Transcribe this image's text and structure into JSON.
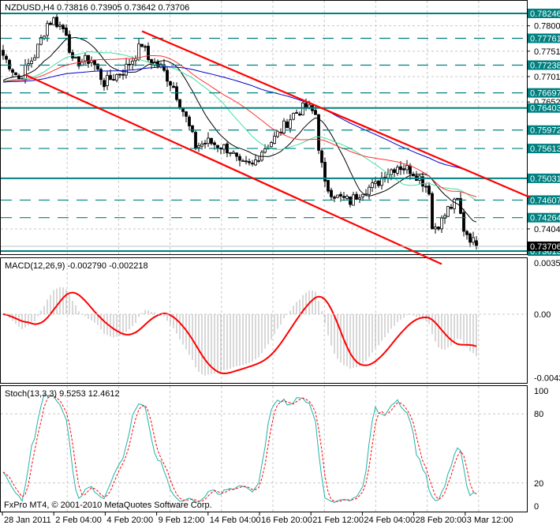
{
  "chart_data": {
    "type": "candlestick",
    "symbol_header": "NZDUSD,H4  0.73816 0.73905 0.73642 0.73706",
    "current_price": "0.73706",
    "price_axis": {
      "ylim": [
        0.7336,
        0.785
      ],
      "plain_ticks": [
        "0.78005",
        "0.77510",
        "0.77015",
        "0.76520",
        "0.74045"
      ],
      "levels": [
        {
          "label": "0.78246",
          "style": "solid"
        },
        {
          "label": "0.77761",
          "style": "dashed"
        },
        {
          "label": "0.77238",
          "style": "dashed"
        },
        {
          "label": "0.76697",
          "style": "dashed"
        },
        {
          "label": "0.76403",
          "style": "solid"
        },
        {
          "label": "0.75972",
          "style": "dashed"
        },
        {
          "label": "0.75613",
          "style": "dashed"
        },
        {
          "label": "0.75031",
          "style": "solid"
        },
        {
          "label": "0.74607",
          "style": "dashed"
        },
        {
          "label": "0.74264",
          "style": "dashed"
        },
        {
          "label": "0.73613",
          "style": "solid"
        }
      ]
    },
    "close_path": [
      [
        0,
        0.7743
      ],
      [
        5,
        0.7697
      ],
      [
        10,
        0.7743
      ],
      [
        14,
        0.7805
      ],
      [
        16,
        0.7812
      ],
      [
        20,
        0.7789
      ],
      [
        22,
        0.7728
      ],
      [
        28,
        0.7735
      ],
      [
        32,
        0.7689
      ],
      [
        38,
        0.7712
      ],
      [
        41,
        0.7735
      ],
      [
        44,
        0.7766
      ],
      [
        46,
        0.7735
      ],
      [
        50,
        0.772
      ],
      [
        54,
        0.7681
      ],
      [
        58,
        0.762
      ],
      [
        61,
        0.7566
      ],
      [
        65,
        0.7574
      ],
      [
        69,
        0.7566
      ],
      [
        72,
        0.7558
      ],
      [
        75,
        0.7528
      ],
      [
        79,
        0.7528
      ],
      [
        82,
        0.7558
      ],
      [
        86,
        0.7581
      ],
      [
        89,
        0.7605
      ],
      [
        92,
        0.7628
      ],
      [
        96,
        0.7643
      ],
      [
        99,
        0.7628
      ],
      [
        100,
        0.7566
      ],
      [
        102,
        0.7489
      ],
      [
        106,
        0.7466
      ],
      [
        110,
        0.7458
      ],
      [
        114,
        0.7481
      ],
      [
        118,
        0.7489
      ],
      [
        121,
        0.7512
      ],
      [
        125,
        0.7528
      ],
      [
        129,
        0.752
      ],
      [
        132,
        0.7505
      ],
      [
        135,
        0.7481
      ],
      [
        136,
        0.7405
      ],
      [
        139,
        0.742
      ],
      [
        141,
        0.7443
      ],
      [
        144,
        0.7458
      ],
      [
        146,
        0.7405
      ],
      [
        150,
        0.73706
      ]
    ],
    "channel": {
      "upper": [
        [
          44,
          0.779
        ],
        [
          167,
          0.7466
        ]
      ],
      "lower": [
        [
          7,
          0.7705
        ],
        [
          139,
          0.7336
        ]
      ]
    },
    "moving_averages": [
      {
        "color": "#000000",
        "period": 14
      },
      {
        "color": "#40e0a0",
        "period": 28
      },
      {
        "color": "#ff3030",
        "period": 40
      },
      {
        "color": "#0000cc",
        "period": 80
      }
    ],
    "time_labels": [
      "28 Jan 2011",
      "2 Feb 04:00",
      "4 Feb 20:00",
      "9 Feb 12:00",
      "14 Feb 04:00",
      "16 Feb 20:00",
      "21 Feb 12:00",
      "24 Feb 04:00",
      "28 Feb 20:00",
      "3 Mar 12:00"
    ],
    "macd": {
      "header": "MACD(12,26,9) -0.002790 -0.002218",
      "ticks": [
        "0.00350",
        "0.00",
        "-0.00434"
      ],
      "ylim": [
        -0.00434,
        0.0035
      ]
    },
    "stoch": {
      "header": "Stoch(13,3,3) 9.5253 12.4612",
      "ticks": [
        "100",
        "80",
        "20",
        "0"
      ],
      "ylim": [
        0,
        100
      ]
    }
  },
  "footer": {
    "copyright": "FxPro MT4, © 2001-2010 MetaQuotes Software Corp."
  },
  "colors": {
    "level": "#008080",
    "channel": "#ff0000",
    "macd_signal": "#ff0000",
    "stoch_main": "#20b2aa",
    "stoch_signal": "#ff0000"
  }
}
